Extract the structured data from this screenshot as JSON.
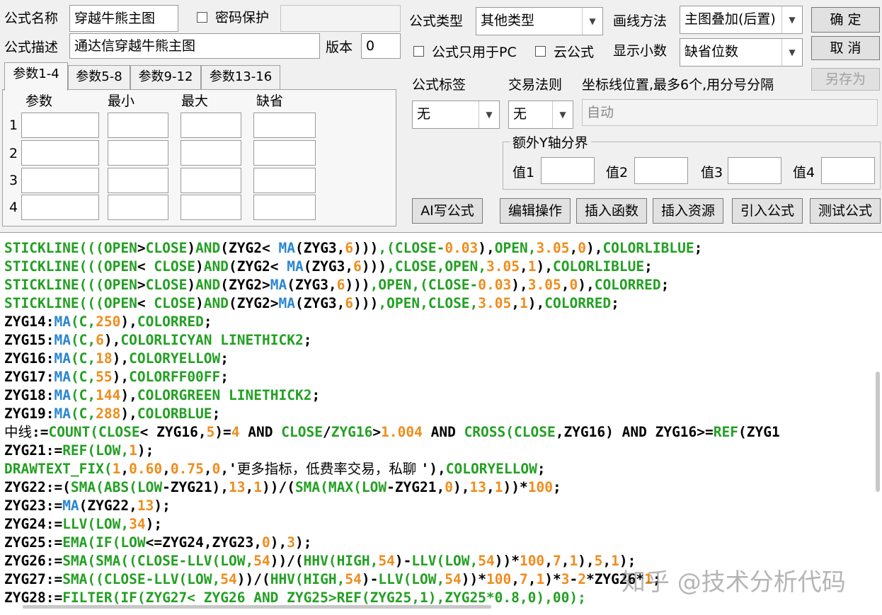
{
  "form": {
    "name_label": "公式名称",
    "name_value": "穿越牛熊主图",
    "password_label": "密码保护",
    "password_value": "",
    "desc_label": "公式描述",
    "desc_value": "通达信穿越牛熊主图",
    "version_label": "版本",
    "version_value": "0",
    "type_label": "公式类型",
    "type_value": "其他类型",
    "draw_label": "画线方法",
    "draw_value": "主图叠加(后置)",
    "pc_only_label": "公式只用于PC",
    "cloud_label": "云公式",
    "decimals_label": "显示小数",
    "decimals_value": "缺省位数",
    "tag_label": "公式标签",
    "tag_value": "无",
    "trade_label": "交易法则",
    "trade_value": "无",
    "axis_label": "坐标线位置,最多6个,用分号分隔",
    "axis_value": "自动",
    "extra_y_label": "额外Y轴分界",
    "val1": "值1",
    "val2": "值2",
    "val3": "值3",
    "val4": "值4"
  },
  "buttons": {
    "ok": "确  定",
    "cancel": "取  消",
    "save_as": "另存为",
    "ai": "AI写公式",
    "edit": "编辑操作",
    "insert_func": "插入函数",
    "insert_res": "插入资源",
    "import": "引入公式",
    "test": "测试公式"
  },
  "tabs": [
    "参数1-4",
    "参数5-8",
    "参数9-12",
    "参数13-16"
  ],
  "params": {
    "headers": [
      "参数",
      "最小",
      "最大",
      "缺省"
    ],
    "rows": [
      "1",
      "2",
      "3",
      "4"
    ]
  },
  "code_lines": [
    [
      [
        "kw",
        "STICKLINE((("
      ],
      [
        "kw",
        "OPEN"
      ],
      [
        "tx",
        ">"
      ],
      [
        "kw",
        "CLOSE"
      ],
      [
        "tx",
        ")"
      ],
      [
        "kw",
        "AND"
      ],
      [
        "tx",
        "(ZYG2< "
      ],
      [
        "fn",
        "MA"
      ],
      [
        "tx",
        "(ZYG3,"
      ],
      [
        "num",
        "6"
      ],
      [
        "tx",
        ")))"
      ],
      [
        "kw",
        ",(CLOSE-"
      ],
      [
        "num",
        "0.03"
      ],
      [
        "tx",
        "),"
      ],
      [
        "kw",
        "OPEN,"
      ],
      [
        "num",
        "3.05"
      ],
      [
        "tx",
        ","
      ],
      [
        "num",
        "0"
      ],
      [
        "tx",
        "),"
      ],
      [
        "kw",
        "COLORLIBLUE"
      ],
      [
        "tx",
        ";"
      ]
    ],
    [
      [
        "kw",
        "STICKLINE((("
      ],
      [
        "kw",
        "OPEN"
      ],
      [
        "tx",
        "< "
      ],
      [
        "kw",
        "CLOSE"
      ],
      [
        "tx",
        ")"
      ],
      [
        "kw",
        "AND"
      ],
      [
        "tx",
        "(ZYG2< "
      ],
      [
        "fn",
        "MA"
      ],
      [
        "tx",
        "(ZYG3,"
      ],
      [
        "num",
        "6"
      ],
      [
        "tx",
        ")))"
      ],
      [
        "kw",
        ",CLOSE,OPEN,"
      ],
      [
        "num",
        "3.05"
      ],
      [
        "tx",
        ","
      ],
      [
        "num",
        "1"
      ],
      [
        "tx",
        "),"
      ],
      [
        "kw",
        "COLORLIBLUE"
      ],
      [
        "tx",
        ";"
      ]
    ],
    [
      [
        "kw",
        "STICKLINE((("
      ],
      [
        "kw",
        "OPEN"
      ],
      [
        "tx",
        ">"
      ],
      [
        "kw",
        "CLOSE"
      ],
      [
        "tx",
        ")"
      ],
      [
        "kw",
        "AND"
      ],
      [
        "tx",
        "(ZYG2>"
      ],
      [
        "fn",
        "MA"
      ],
      [
        "tx",
        "(ZYG3,"
      ],
      [
        "num",
        "6"
      ],
      [
        "tx",
        ")))"
      ],
      [
        "kw",
        ",OPEN,(CLOSE-"
      ],
      [
        "num",
        "0.03"
      ],
      [
        "tx",
        "),"
      ],
      [
        "num",
        "3.05"
      ],
      [
        "tx",
        ","
      ],
      [
        "num",
        "0"
      ],
      [
        "tx",
        "),"
      ],
      [
        "kw",
        "COLORRED"
      ],
      [
        "tx",
        ";"
      ]
    ],
    [
      [
        "kw",
        "STICKLINE((("
      ],
      [
        "kw",
        "OPEN"
      ],
      [
        "tx",
        "< "
      ],
      [
        "kw",
        "CLOSE"
      ],
      [
        "tx",
        ")"
      ],
      [
        "kw",
        "AND"
      ],
      [
        "tx",
        "(ZYG2>"
      ],
      [
        "fn",
        "MA"
      ],
      [
        "tx",
        "(ZYG3,"
      ],
      [
        "num",
        "6"
      ],
      [
        "tx",
        ")))"
      ],
      [
        "kw",
        ",OPEN,CLOSE,"
      ],
      [
        "num",
        "3.05"
      ],
      [
        "tx",
        ","
      ],
      [
        "num",
        "1"
      ],
      [
        "tx",
        "),"
      ],
      [
        "kw",
        "COLORRED"
      ],
      [
        "tx",
        ";"
      ]
    ],
    [
      [
        "tx",
        "ZYG14:"
      ],
      [
        "fn",
        "MA"
      ],
      [
        "kw",
        "(C,"
      ],
      [
        "num",
        "250"
      ],
      [
        "tx",
        "),"
      ],
      [
        "kw",
        "COLORRED"
      ],
      [
        "tx",
        ";"
      ]
    ],
    [
      [
        "tx",
        "ZYG15:"
      ],
      [
        "fn",
        "MA"
      ],
      [
        "kw",
        "(C,"
      ],
      [
        "num",
        "6"
      ],
      [
        "tx",
        "),"
      ],
      [
        "kw",
        "COLORLICYAN LINETHICK2"
      ],
      [
        "tx",
        ";"
      ]
    ],
    [
      [
        "tx",
        "ZYG16:"
      ],
      [
        "fn",
        "MA"
      ],
      [
        "kw",
        "(C,"
      ],
      [
        "num",
        "18"
      ],
      [
        "tx",
        "),"
      ],
      [
        "kw",
        "COLORYELLOW"
      ],
      [
        "tx",
        ";"
      ]
    ],
    [
      [
        "tx",
        "ZYG17:"
      ],
      [
        "fn",
        "MA"
      ],
      [
        "kw",
        "(C,"
      ],
      [
        "num",
        "55"
      ],
      [
        "tx",
        "),"
      ],
      [
        "kw",
        "COLORFF00FF"
      ],
      [
        "tx",
        ";"
      ]
    ],
    [
      [
        "tx",
        "ZYG18:"
      ],
      [
        "fn",
        "MA"
      ],
      [
        "kw",
        "(C,"
      ],
      [
        "num",
        "144"
      ],
      [
        "tx",
        "),"
      ],
      [
        "kw",
        "COLORGREEN LINETHICK2"
      ],
      [
        "tx",
        ";"
      ]
    ],
    [
      [
        "tx",
        "ZYG19:"
      ],
      [
        "fn",
        "MA"
      ],
      [
        "kw",
        "(C,"
      ],
      [
        "num",
        "288"
      ],
      [
        "tx",
        "),"
      ],
      [
        "kw",
        "COLORBLUE"
      ],
      [
        "tx",
        ";"
      ]
    ],
    [
      [
        "cn",
        "中线"
      ],
      [
        "tx",
        ":="
      ],
      [
        "kw",
        "COUNT(CLOSE"
      ],
      [
        "tx",
        "< ZYG16,"
      ],
      [
        "num",
        "5"
      ],
      [
        "tx",
        ")="
      ],
      [
        "num",
        "4"
      ],
      [
        "tx",
        " AND "
      ],
      [
        "kw",
        "CLOSE"
      ],
      [
        "tx",
        "/"
      ],
      [
        "kw",
        "ZYG16"
      ],
      [
        "tx",
        ">"
      ],
      [
        "num",
        "1.004"
      ],
      [
        "tx",
        " AND "
      ],
      [
        "kw",
        "CROSS(CLOSE"
      ],
      [
        "tx",
        ",ZYG16) AND ZYG16>="
      ],
      [
        "kw",
        "REF"
      ],
      [
        "tx",
        "(ZYG1"
      ]
    ],
    [
      [
        "tx",
        "ZYG21:="
      ],
      [
        "kw",
        "REF(LOW,"
      ],
      [
        "num",
        "1"
      ],
      [
        "tx",
        ");"
      ]
    ],
    [
      [
        "kw",
        "DRAWTEXT_FIX("
      ],
      [
        "num",
        "1"
      ],
      [
        "tx",
        ","
      ],
      [
        "num",
        "0.60"
      ],
      [
        "tx",
        ","
      ],
      [
        "num",
        "0.75"
      ],
      [
        "tx",
        ","
      ],
      [
        "num",
        "0"
      ],
      [
        "tx",
        ",'"
      ],
      [
        "cn",
        "更多指标，低费率交易，私聊 "
      ],
      [
        "tx",
        "'),"
      ],
      [
        "kw",
        "COLORYELLOW"
      ],
      [
        "tx",
        ";"
      ]
    ],
    [
      [
        "tx",
        "ZYG22:=("
      ],
      [
        "kw",
        "SMA(ABS(LOW"
      ],
      [
        "tx",
        "-ZYG21),"
      ],
      [
        "num",
        "13"
      ],
      [
        "tx",
        ","
      ],
      [
        "num",
        "1"
      ],
      [
        "tx",
        "))/("
      ],
      [
        "kw",
        "SMA(MAX(LOW"
      ],
      [
        "tx",
        "-ZYG21,"
      ],
      [
        "num",
        "0"
      ],
      [
        "tx",
        "),"
      ],
      [
        "num",
        "13"
      ],
      [
        "tx",
        ","
      ],
      [
        "num",
        "1"
      ],
      [
        "tx",
        "))*"
      ],
      [
        "num",
        "100"
      ],
      [
        "tx",
        ";"
      ]
    ],
    [
      [
        "tx",
        "ZYG23:="
      ],
      [
        "fn",
        "MA"
      ],
      [
        "tx",
        "(ZYG22,"
      ],
      [
        "num",
        "13"
      ],
      [
        "tx",
        ");"
      ]
    ],
    [
      [
        "tx",
        "ZYG24:="
      ],
      [
        "kw",
        "LLV(LOW,"
      ],
      [
        "num",
        "34"
      ],
      [
        "tx",
        ");"
      ]
    ],
    [
      [
        "tx",
        "ZYG25:="
      ],
      [
        "kw",
        "EMA(IF(LOW"
      ],
      [
        "tx",
        "<=ZYG24,ZYG23,"
      ],
      [
        "num",
        "0"
      ],
      [
        "tx",
        "),"
      ],
      [
        "num",
        "3"
      ],
      [
        "tx",
        ");"
      ]
    ],
    [
      [
        "tx",
        "ZYG26:="
      ],
      [
        "kw",
        "SMA(SMA((CLOSE-LLV(LOW,"
      ],
      [
        "num",
        "54"
      ],
      [
        "tx",
        "))/("
      ],
      [
        "kw",
        "HHV(HIGH,"
      ],
      [
        "num",
        "54"
      ],
      [
        "tx",
        ")-"
      ],
      [
        "kw",
        "LLV(LOW,"
      ],
      [
        "num",
        "54"
      ],
      [
        "tx",
        "))*"
      ],
      [
        "num",
        "100"
      ],
      [
        "tx",
        ","
      ],
      [
        "num",
        "7"
      ],
      [
        "tx",
        ","
      ],
      [
        "num",
        "1"
      ],
      [
        "tx",
        "),"
      ],
      [
        "num",
        "5"
      ],
      [
        "tx",
        ","
      ],
      [
        "num",
        "1"
      ],
      [
        "tx",
        ");"
      ]
    ],
    [
      [
        "tx",
        "ZYG27:="
      ],
      [
        "kw",
        "SMA((CLOSE-LLV(LOW,"
      ],
      [
        "num",
        "54"
      ],
      [
        "tx",
        "))/("
      ],
      [
        "kw",
        "HHV(HIGH,"
      ],
      [
        "num",
        "54"
      ],
      [
        "tx",
        ")-"
      ],
      [
        "kw",
        "LLV(LOW,"
      ],
      [
        "num",
        "54"
      ],
      [
        "tx",
        "))*"
      ],
      [
        "num",
        "100"
      ],
      [
        "tx",
        ","
      ],
      [
        "num",
        "7"
      ],
      [
        "tx",
        ","
      ],
      [
        "num",
        "1"
      ],
      [
        "tx",
        ")*"
      ],
      [
        "num",
        "3"
      ],
      [
        "tx",
        "-"
      ],
      [
        "num",
        "2"
      ],
      [
        "tx",
        "*ZYG26*"
      ],
      [
        "num",
        "1"
      ],
      [
        "tx",
        ";"
      ]
    ],
    [
      [
        "tx",
        "ZYG28:="
      ],
      [
        "kw",
        "FILTER(IF(ZYG27< ZYG26 AND ZYG25>REF(ZYG25,1),ZYG25*0.8,0),00);"
      ]
    ]
  ],
  "watermark": "知乎 @技术分析代码"
}
